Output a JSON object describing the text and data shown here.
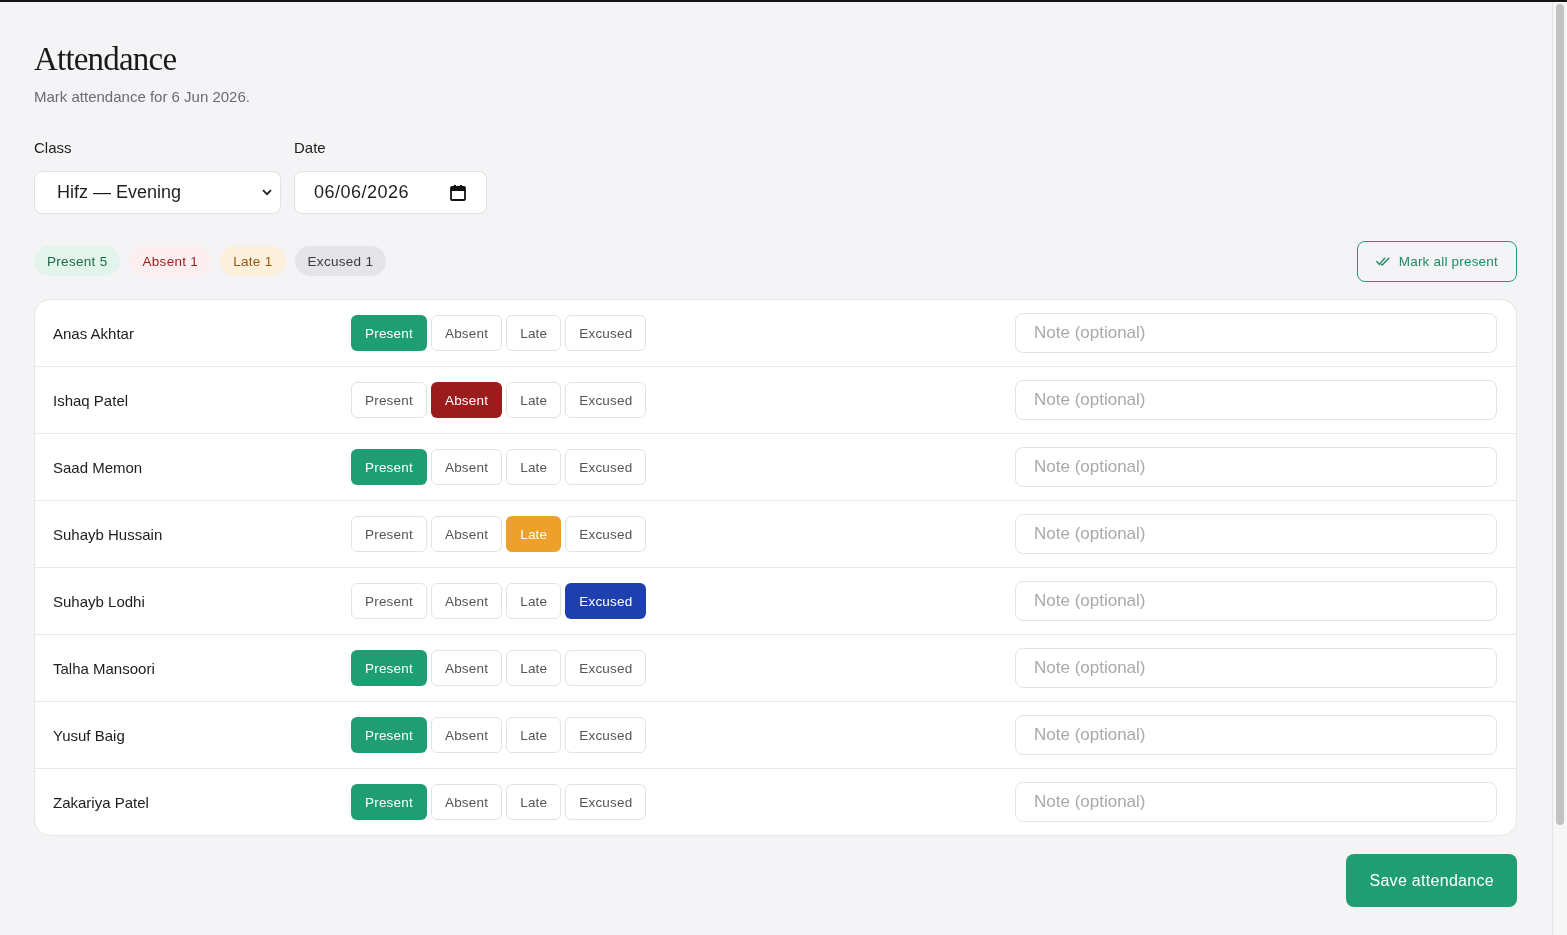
{
  "page": {
    "title": "Attendance",
    "subtitle": "Mark attendance for 6 Jun 2026."
  },
  "filters": {
    "class": {
      "label": "Class",
      "value": "Hifz — Evening"
    },
    "date": {
      "label": "Date",
      "value": "06/06/2026"
    }
  },
  "summary": [
    {
      "kind": "present",
      "label": "Present 5"
    },
    {
      "kind": "absent",
      "label": "Absent 1"
    },
    {
      "kind": "late",
      "label": "Late 1"
    },
    {
      "kind": "excused",
      "label": "Excused 1"
    }
  ],
  "mark_all_button": "Mark all present",
  "students": [
    {
      "name": "Anas Akhtar",
      "options": [
        {
          "kind": "present",
          "label": "Present",
          "selected": true
        },
        {
          "kind": "absent",
          "label": "Absent",
          "selected": false
        },
        {
          "kind": "late",
          "label": "Late",
          "selected": false
        },
        {
          "kind": "excused",
          "label": "Excused",
          "selected": false
        }
      ],
      "note": {
        "placeholder": "Note (optional)"
      }
    },
    {
      "name": "Ishaq Patel",
      "options": [
        {
          "kind": "present",
          "label": "Present",
          "selected": false
        },
        {
          "kind": "absent",
          "label": "Absent",
          "selected": true
        },
        {
          "kind": "late",
          "label": "Late",
          "selected": false
        },
        {
          "kind": "excused",
          "label": "Excused",
          "selected": false
        }
      ],
      "note": {
        "placeholder": "Note (optional)"
      }
    },
    {
      "name": "Saad Memon",
      "options": [
        {
          "kind": "present",
          "label": "Present",
          "selected": true
        },
        {
          "kind": "absent",
          "label": "Absent",
          "selected": false
        },
        {
          "kind": "late",
          "label": "Late",
          "selected": false
        },
        {
          "kind": "excused",
          "label": "Excused",
          "selected": false
        }
      ],
      "note": {
        "placeholder": "Note (optional)"
      }
    },
    {
      "name": "Suhayb Hussain",
      "options": [
        {
          "kind": "present",
          "label": "Present",
          "selected": false
        },
        {
          "kind": "absent",
          "label": "Absent",
          "selected": false
        },
        {
          "kind": "late",
          "label": "Late",
          "selected": true
        },
        {
          "kind": "excused",
          "label": "Excused",
          "selected": false
        }
      ],
      "note": {
        "placeholder": "Note (optional)"
      }
    },
    {
      "name": "Suhayb Lodhi",
      "options": [
        {
          "kind": "present",
          "label": "Present",
          "selected": false
        },
        {
          "kind": "absent",
          "label": "Absent",
          "selected": false
        },
        {
          "kind": "late",
          "label": "Late",
          "selected": false
        },
        {
          "kind": "excused",
          "label": "Excused",
          "selected": true
        }
      ],
      "note": {
        "placeholder": "Note (optional)"
      }
    },
    {
      "name": "Talha Mansoori",
      "options": [
        {
          "kind": "present",
          "label": "Present",
          "selected": true
        },
        {
          "kind": "absent",
          "label": "Absent",
          "selected": false
        },
        {
          "kind": "late",
          "label": "Late",
          "selected": false
        },
        {
          "kind": "excused",
          "label": "Excused",
          "selected": false
        }
      ],
      "note": {
        "placeholder": "Note (optional)"
      }
    },
    {
      "name": "Yusuf Baig",
      "options": [
        {
          "kind": "present",
          "label": "Present",
          "selected": true
        },
        {
          "kind": "absent",
          "label": "Absent",
          "selected": false
        },
        {
          "kind": "late",
          "label": "Late",
          "selected": false
        },
        {
          "kind": "excused",
          "label": "Excused",
          "selected": false
        }
      ],
      "note": {
        "placeholder": "Note (optional)"
      }
    },
    {
      "name": "Zakariya Patel",
      "options": [
        {
          "kind": "present",
          "label": "Present",
          "selected": true
        },
        {
          "kind": "absent",
          "label": "Absent",
          "selected": false
        },
        {
          "kind": "late",
          "label": "Late",
          "selected": false
        },
        {
          "kind": "excused",
          "label": "Excused",
          "selected": false
        }
      ],
      "note": {
        "placeholder": "Note (optional)"
      }
    }
  ],
  "save_button": "Save attendance"
}
